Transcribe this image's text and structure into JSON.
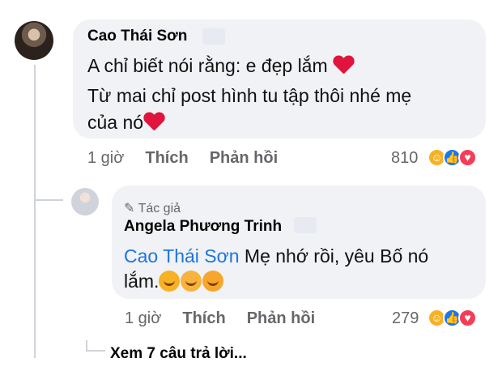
{
  "comment": {
    "author": "Cao Thái Sơn",
    "line1": "A chỉ biết nói rằng: e đẹp lắm",
    "line2": "Từ mai chỉ post hình tu tập thôi nhé mẹ",
    "line3": "của nó",
    "time": "1 giờ",
    "like": "Thích",
    "reply": "Phản hồi",
    "reaction_count": "810"
  },
  "reply": {
    "badge_icon": "pen-icon",
    "badge": "Tác giả",
    "author": "Angela Phương Trinh",
    "mention": "Cao Thái Sơn",
    "text1": " Mẹ nhớ rồi, yêu Bố nó",
    "text2": "lắm.",
    "time": "1 giờ",
    "like": "Thích",
    "reply": "Phản hồi",
    "reaction_count": "279"
  },
  "more_replies": "Xem 7 câu trả lời..."
}
